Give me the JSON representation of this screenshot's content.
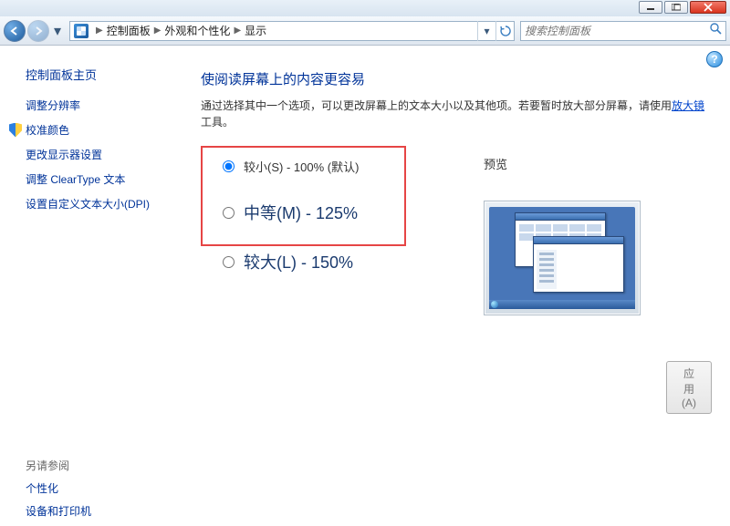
{
  "titlebar": {
    "minimize": "minimize",
    "maximize": "maximize",
    "close": "close"
  },
  "nav": {
    "back": "back",
    "forward": "forward",
    "breadcrumb": [
      "控制面板",
      "外观和个性化",
      "显示"
    ],
    "refresh": "刷新",
    "search_placeholder": "搜索控制面板"
  },
  "help_icon": "?",
  "sidebar": {
    "home": "控制面板主页",
    "items": [
      {
        "label": "调整分辨率",
        "shield": false
      },
      {
        "label": "校准颜色",
        "shield": true
      },
      {
        "label": "更改显示器设置",
        "shield": false
      },
      {
        "label": "调整 ClearType 文本",
        "shield": false
      },
      {
        "label": "设置自定义文本大小(DPI)",
        "shield": false
      }
    ],
    "see_also_title": "另请参阅",
    "see_also": [
      "个性化",
      "设备和打印机"
    ]
  },
  "main": {
    "title": "使阅读屏幕上的内容更容易",
    "desc_pre": "通过选择其中一个选项，可以更改屏幕上的文本大小以及其他项。若要暂时放大部分屏幕，请使用",
    "desc_link": "放大镜",
    "desc_post": "工具。",
    "options": [
      {
        "label": "较小(S) - 100% (默认)",
        "checked": true,
        "size": "small"
      },
      {
        "label": "中等(M) - 125%",
        "checked": false,
        "size": "medium"
      },
      {
        "label": "较大(L) - 150%",
        "checked": false,
        "size": "large"
      }
    ],
    "preview_label": "预览",
    "apply_button": "应用(A)"
  }
}
